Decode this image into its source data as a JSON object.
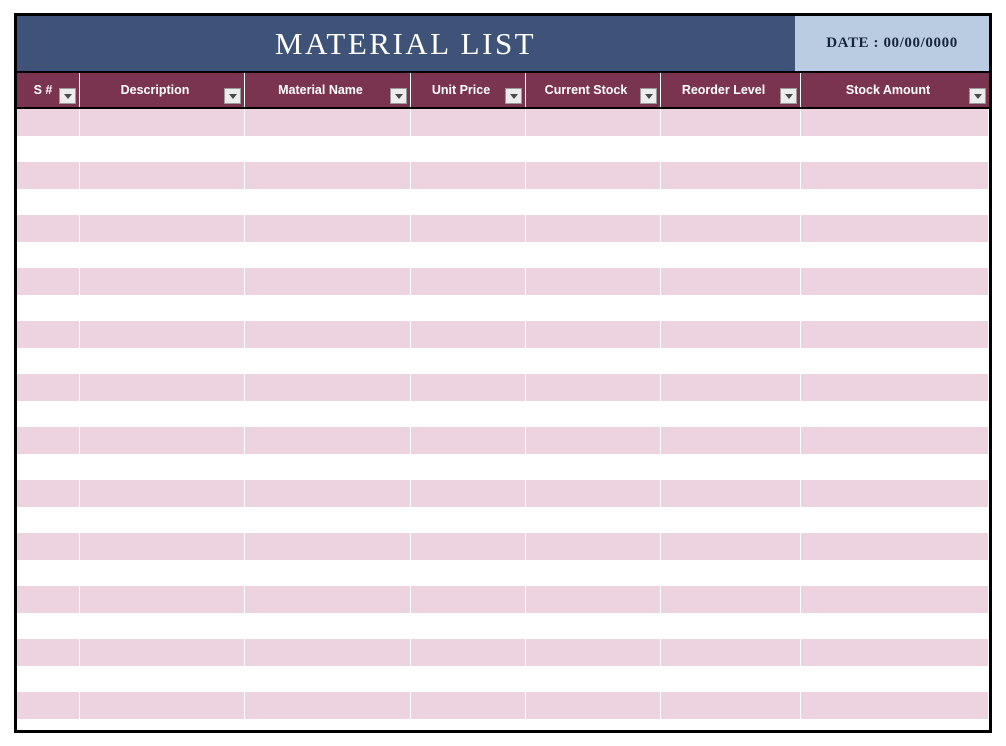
{
  "document": {
    "title": "MATERIAL LIST",
    "date_label": "DATE : 00/00/0000"
  },
  "colors": {
    "title_band": "#3E5377",
    "date_box": "#B9CCE2",
    "header_row": "#7B3450",
    "row_fill": "#EDD3DF",
    "row_alt": "#FFFFFF",
    "frame_border": "#000000",
    "header_text": "#FFFFFF"
  },
  "table": {
    "columns": [
      {
        "label": "S #",
        "filter_icon": "chevron-down-icon"
      },
      {
        "label": "Description",
        "filter_icon": "chevron-down-icon"
      },
      {
        "label": "Material Name",
        "filter_icon": "chevron-down-icon"
      },
      {
        "label": "Unit Price",
        "filter_icon": "chevron-down-icon"
      },
      {
        "label": "Current Stock",
        "filter_icon": "chevron-down-icon"
      },
      {
        "label": "Reorder Level",
        "filter_icon": "chevron-down-icon"
      },
      {
        "label": "Stock Amount",
        "filter_icon": "chevron-down-icon"
      }
    ],
    "row_count": 23,
    "rows": [
      {
        "filled": true,
        "cells": [
          "",
          "",
          "",
          "",
          "",
          "",
          ""
        ]
      },
      {
        "filled": false,
        "cells": [
          "",
          "",
          "",
          "",
          "",
          "",
          ""
        ]
      },
      {
        "filled": true,
        "cells": [
          "",
          "",
          "",
          "",
          "",
          "",
          ""
        ]
      },
      {
        "filled": false,
        "cells": [
          "",
          "",
          "",
          "",
          "",
          "",
          ""
        ]
      },
      {
        "filled": true,
        "cells": [
          "",
          "",
          "",
          "",
          "",
          "",
          ""
        ]
      },
      {
        "filled": false,
        "cells": [
          "",
          "",
          "",
          "",
          "",
          "",
          ""
        ]
      },
      {
        "filled": true,
        "cells": [
          "",
          "",
          "",
          "",
          "",
          "",
          ""
        ]
      },
      {
        "filled": false,
        "cells": [
          "",
          "",
          "",
          "",
          "",
          "",
          ""
        ]
      },
      {
        "filled": true,
        "cells": [
          "",
          "",
          "",
          "",
          "",
          "",
          ""
        ]
      },
      {
        "filled": false,
        "cells": [
          "",
          "",
          "",
          "",
          "",
          "",
          ""
        ]
      },
      {
        "filled": true,
        "cells": [
          "",
          "",
          "",
          "",
          "",
          "",
          ""
        ]
      },
      {
        "filled": false,
        "cells": [
          "",
          "",
          "",
          "",
          "",
          "",
          ""
        ]
      },
      {
        "filled": true,
        "cells": [
          "",
          "",
          "",
          "",
          "",
          "",
          ""
        ]
      },
      {
        "filled": false,
        "cells": [
          "",
          "",
          "",
          "",
          "",
          "",
          ""
        ]
      },
      {
        "filled": true,
        "cells": [
          "",
          "",
          "",
          "",
          "",
          "",
          ""
        ]
      },
      {
        "filled": false,
        "cells": [
          "",
          "",
          "",
          "",
          "",
          "",
          ""
        ]
      },
      {
        "filled": true,
        "cells": [
          "",
          "",
          "",
          "",
          "",
          "",
          ""
        ]
      },
      {
        "filled": false,
        "cells": [
          "",
          "",
          "",
          "",
          "",
          "",
          ""
        ]
      },
      {
        "filled": true,
        "cells": [
          "",
          "",
          "",
          "",
          "",
          "",
          ""
        ]
      },
      {
        "filled": false,
        "cells": [
          "",
          "",
          "",
          "",
          "",
          "",
          ""
        ]
      },
      {
        "filled": true,
        "cells": [
          "",
          "",
          "",
          "",
          "",
          "",
          ""
        ]
      },
      {
        "filled": false,
        "cells": [
          "",
          "",
          "",
          "",
          "",
          "",
          ""
        ]
      },
      {
        "filled": true,
        "cells": [
          "",
          "",
          "",
          "",
          "",
          "",
          ""
        ]
      }
    ]
  }
}
